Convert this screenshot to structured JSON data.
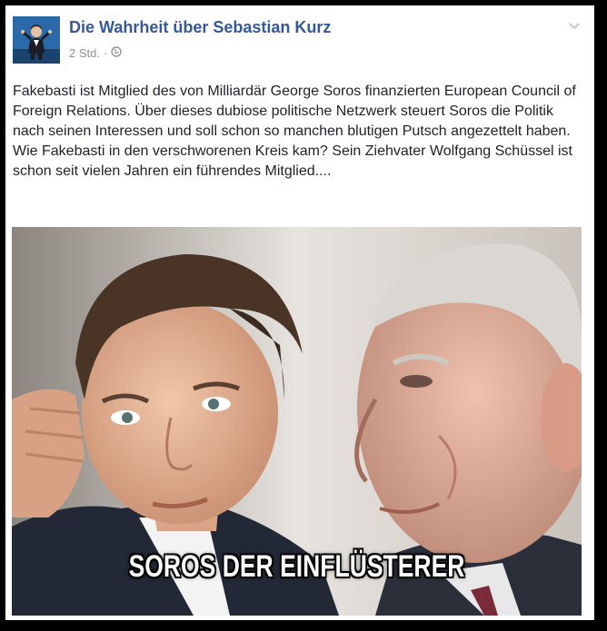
{
  "post": {
    "page_name": "Die Wahrheit über Sebastian Kurz",
    "timestamp": "2 Std.",
    "separator": "·",
    "privacy_icon": "globe-icon",
    "menu_icon": "chevron-down-icon",
    "text": "Fakebasti ist Mitglied des von Milliardär George Soros finanzierten European Council of Foreign Relations. Über dieses dubiose politische Netzwerk steuert Soros die Politik nach seinen Interessen und soll schon so manchen blutigen Putsch angezettelt haben. Wie Fakebasti in den verschworenen Kreis kam? Sein Ziehvater Wolfgang Schüssel ist schon seit vielen Jahren ein führendes Mitglied....",
    "image_caption": "SOROS DER EINFLÜSTERER"
  },
  "colors": {
    "page_name": "#365899",
    "meta": "#90949c",
    "text": "#1d2129",
    "avatar_bg": "#1d5a96"
  }
}
